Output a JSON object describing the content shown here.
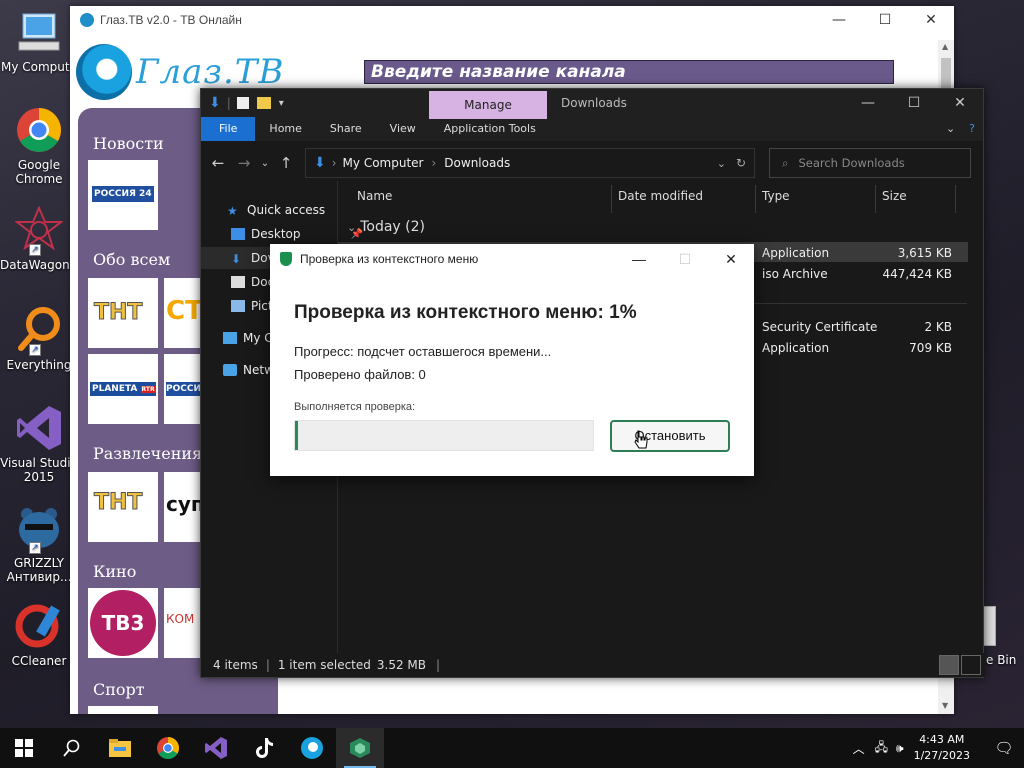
{
  "desktop": {
    "icons": [
      {
        "label": "My Compute",
        "icon": "computer-icon"
      },
      {
        "label": "Google Chrome",
        "icon": "chrome-icon"
      },
      {
        "label": "DataWagon...",
        "icon": "datawagon-icon"
      },
      {
        "label": "Everything",
        "icon": "everything-icon"
      },
      {
        "label": "Visual Studio 2015",
        "icon": "visual-studio-icon"
      },
      {
        "label": "GRIZZLY Антивир...",
        "icon": "grizzly-icon"
      },
      {
        "label": "CCleaner",
        "icon": "ccleaner-icon"
      }
    ],
    "recycle_label": "e Bin"
  },
  "glaz": {
    "title": "Глаз.ТВ v2.0 - ТВ Онлайн",
    "brand": "Глаз.ТВ",
    "search_placeholder": "Введите название канала",
    "categories": [
      {
        "label": "Новости"
      },
      {
        "label": "Обо всем"
      },
      {
        "label": "Развлечения"
      },
      {
        "label": "Кино"
      },
      {
        "label": "Спорт"
      }
    ],
    "channels": {
      "rossiya24": "РОССИЯ 24",
      "tnt": "ТНТ",
      "sts": "СТ",
      "planeta": "PLANETA",
      "planeta_badge": "RTR",
      "rossiya": "РОССИ",
      "tnt_serebro": "ТНТ",
      "super": "супе",
      "tv3": "ТВ3",
      "kom": "КОМ"
    }
  },
  "explorer": {
    "ribbon_context": "Manage",
    "title": "Downloads",
    "tabs": [
      "File",
      "Home",
      "Share",
      "View",
      "Application Tools"
    ],
    "breadcrumb": [
      "My Computer",
      "Downloads"
    ],
    "search_placeholder": "Search Downloads",
    "nav": [
      {
        "label": "Quick access"
      },
      {
        "label": "Desktop"
      },
      {
        "label": "Dov"
      },
      {
        "label": "Doc"
      },
      {
        "label": "Pict"
      },
      {
        "label": "My C"
      },
      {
        "label": "Netw"
      }
    ],
    "columns": [
      "Name",
      "Date modified",
      "Type",
      "Size"
    ],
    "group": "Today (2)",
    "files": [
      {
        "type": "Application",
        "size": "3,615 KB"
      },
      {
        "type": "iso Archive",
        "size": "447,424 KB"
      },
      {
        "type": "Security Certificate",
        "size": "2 KB"
      },
      {
        "type": "Application",
        "size": "709 KB"
      }
    ],
    "status": {
      "items": "4 items",
      "selected": "1 item selected",
      "size": "3.52 MB"
    }
  },
  "dialog": {
    "title": "Проверка из контекстного меню",
    "heading": "Проверка из контекстного меню: 1%",
    "progress_text": "Прогресс: подсчет оставшегося времени...",
    "files_checked": "Проверено файлов: 0",
    "running_label": "Выполняется проверка:",
    "progress_percent": 1,
    "stop_button": "Остановить",
    "accent": "#2b8a5c"
  },
  "taskbar": {
    "apps": [
      "start-icon",
      "search-icon",
      "file-explorer-icon",
      "chrome-icon",
      "visual-studio-icon",
      "tiktok-icon",
      "glaz-tv-icon",
      "grizzly-icon"
    ],
    "time": "4:43 AM",
    "date": "1/27/2023"
  }
}
